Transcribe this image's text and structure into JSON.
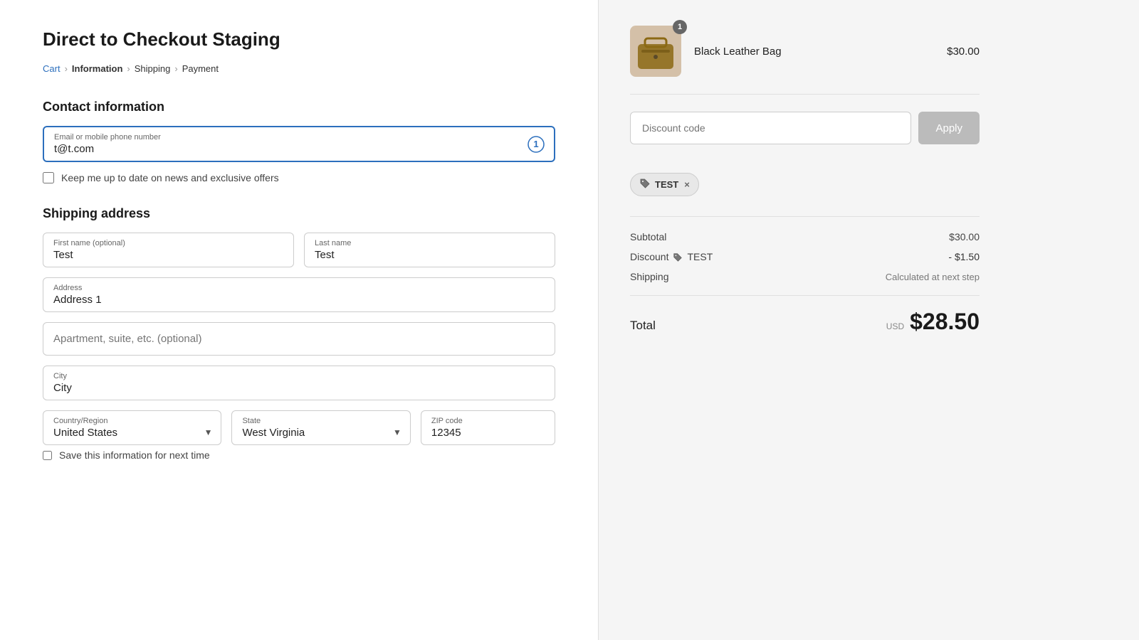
{
  "page": {
    "title": "Direct to Checkout Staging"
  },
  "breadcrumb": {
    "cart": "Cart",
    "information": "Information",
    "shipping": "Shipping",
    "payment": "Payment"
  },
  "contact": {
    "section_title": "Contact information",
    "email_label": "Email or mobile phone number",
    "email_value": "t@t.com",
    "newsletter_label": "Keep me up to date on news and exclusive offers"
  },
  "shipping": {
    "section_title": "Shipping address",
    "first_name_label": "First name (optional)",
    "first_name_value": "Test",
    "last_name_label": "Last name",
    "last_name_value": "Test",
    "address_label": "Address",
    "address_value": "Address 1",
    "apartment_placeholder": "Apartment, suite, etc. (optional)",
    "city_label": "City",
    "city_value": "City",
    "country_label": "Country/Region",
    "country_value": "United States",
    "state_label": "State",
    "state_value": "West Virginia",
    "zip_label": "ZIP code",
    "zip_value": "12345",
    "save_label": "Save this information for next time"
  },
  "order": {
    "product_name": "Black Leather Bag",
    "product_price": "$30.00",
    "product_badge": "1",
    "discount_placeholder": "Discount code",
    "apply_label": "Apply",
    "discount_tag": "TEST",
    "subtotal_label": "Subtotal",
    "subtotal_value": "$30.00",
    "discount_label": "Discount",
    "discount_code_tag": "TEST",
    "discount_value": "- $1.50",
    "shipping_label": "Shipping",
    "shipping_value": "Calculated at next step",
    "total_label": "Total",
    "total_currency": "USD",
    "total_value": "$28.50"
  }
}
